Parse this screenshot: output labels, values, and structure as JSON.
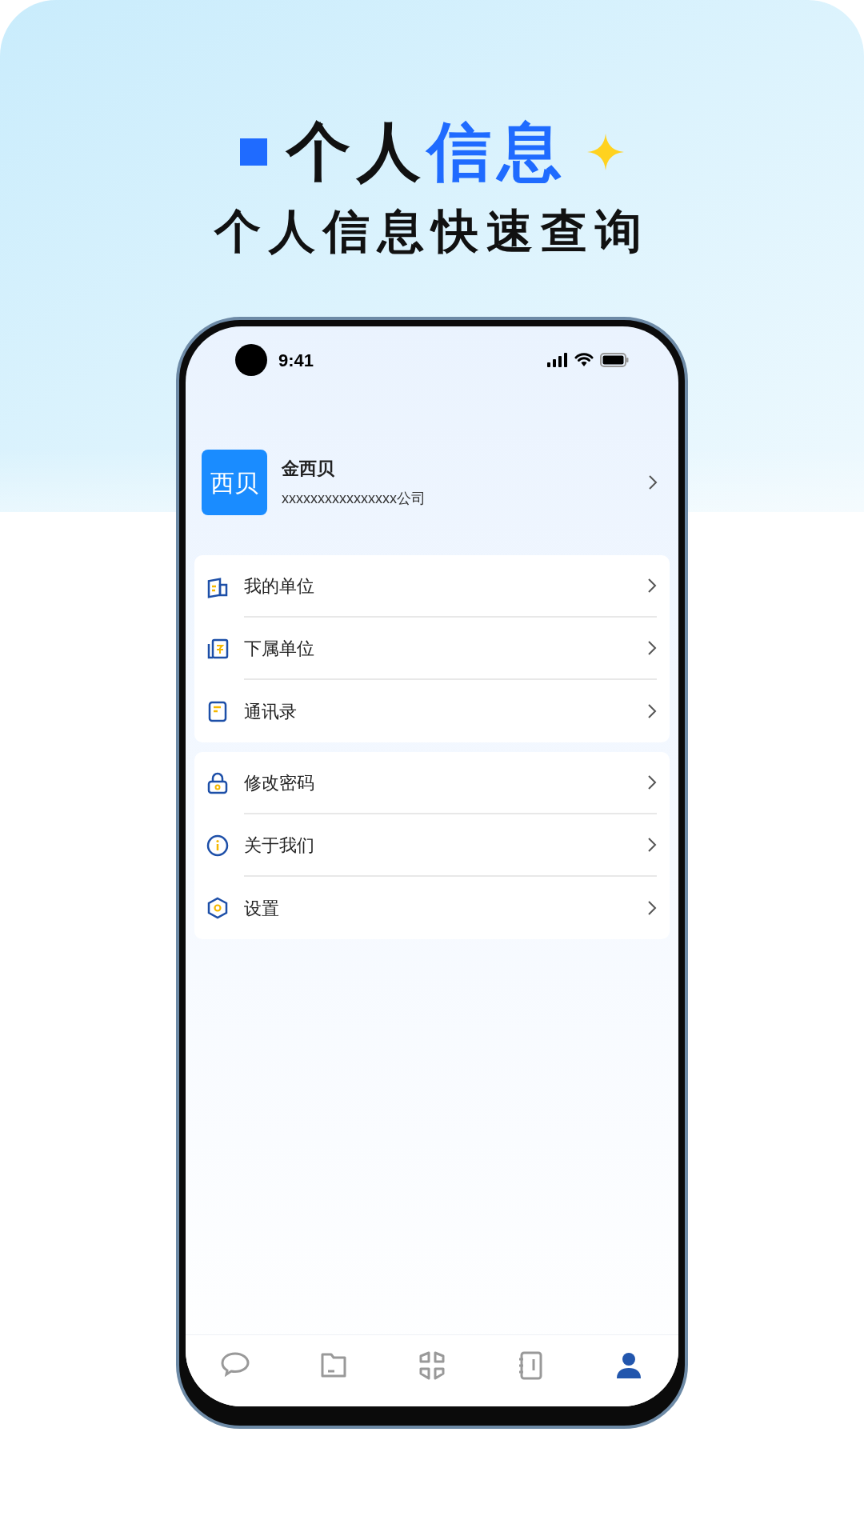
{
  "headline": {
    "title_dark": "个人",
    "title_accent": "信息",
    "subtitle": "个人信息快速查询"
  },
  "status_bar": {
    "time": "9:41"
  },
  "profile": {
    "avatar_text": "西贝",
    "name": "金西贝",
    "company": "xxxxxxxxxxxxxxxx公司"
  },
  "menu_groups": [
    [
      {
        "label": "我的单位"
      },
      {
        "label": "下属单位"
      },
      {
        "label": "通讯录"
      }
    ],
    [
      {
        "label": "修改密码"
      },
      {
        "label": "关于我们"
      },
      {
        "label": "设置"
      }
    ]
  ],
  "tab_bar": [
    {
      "selected": false
    },
    {
      "selected": false
    },
    {
      "selected": false
    },
    {
      "selected": false
    },
    {
      "selected": true
    }
  ]
}
